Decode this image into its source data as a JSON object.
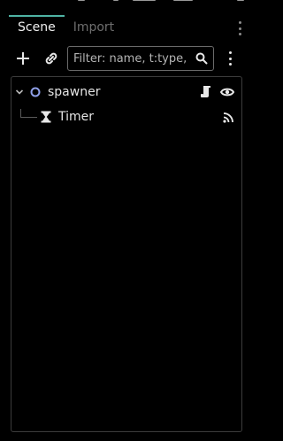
{
  "tabs": [
    {
      "label": "Scene",
      "active": true
    },
    {
      "label": "Import",
      "active": false
    }
  ],
  "toolbar": {
    "add_icon": "plus-icon",
    "link_icon": "link-icon",
    "filter_placeholder": "Filter: name, t:type,",
    "filter_value": "",
    "search_icon": "search-icon",
    "menu_icon": "kebab-icon"
  },
  "tree": {
    "nodes": [
      {
        "label": "spawner",
        "icon": "node-circle-icon",
        "expanded": true,
        "actions": [
          "script-icon",
          "eye-icon"
        ]
      },
      {
        "label": "Timer",
        "icon": "hourglass-icon",
        "actions": [
          "signal-icon"
        ]
      }
    ]
  },
  "colors": {
    "background": "#000000",
    "active_tab_accent": "#4fb3a4",
    "node_icon": "#8fa0e8",
    "text": "#e0e0e0",
    "muted_text": "#6e6e6e"
  }
}
